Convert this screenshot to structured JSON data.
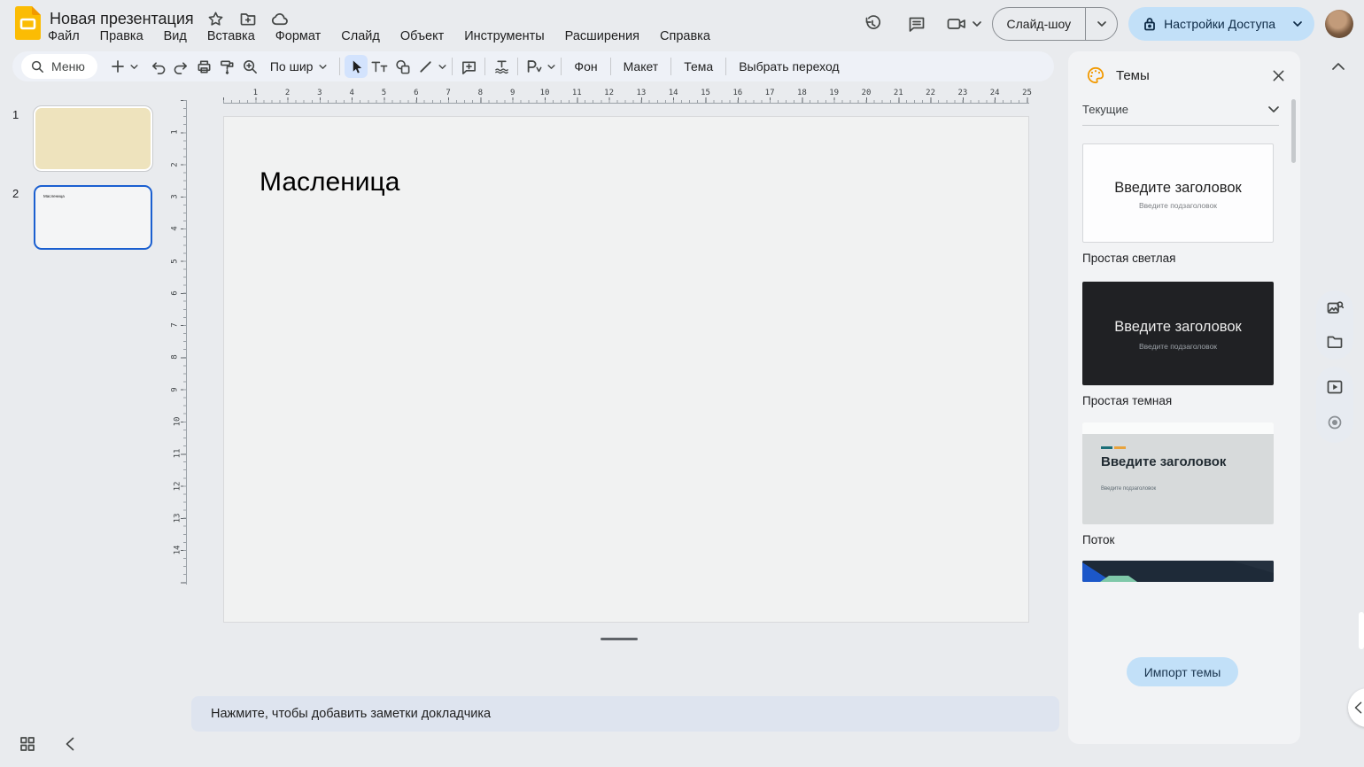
{
  "colors": {
    "page_bg": "#e9ebee",
    "toolbar_bg": "#eef1f7",
    "icon_gray": "#444746",
    "accent_blue": "#1a73e8",
    "selection_blue": "#d3e3fd",
    "share_button_bg": "#c2e0f8",
    "share_button_text": "#0d2a46",
    "logo_yellow": "#fbbc04",
    "logo_fold": "#f29900",
    "palette_amber": "#f29900",
    "slide1_fill": "#eee3bd",
    "selected_border": "#1a5fd0",
    "notes_bg": "#dee4ef",
    "panel_bg": "#f2f3f5",
    "dark_card": "#202124",
    "flow_card": "#d7dadb",
    "stream_navy": "#1e2a38",
    "stream_blue": "#1c57c9",
    "stream_green": "#7fc8a9"
  },
  "header": {
    "title": "Новая презентация",
    "menus": [
      "Файл",
      "Правка",
      "Вид",
      "Вставка",
      "Формат",
      "Слайд",
      "Объект",
      "Инструменты",
      "Расширения",
      "Справка"
    ],
    "slideshow_label": "Слайд-шоу",
    "share_label": "Настройки Доступа"
  },
  "toolbar": {
    "search_label": "Меню",
    "zoom_fit_label": "По шир",
    "background_label": "Фон",
    "layout_label": "Макет",
    "theme_label": "Тема",
    "transition_label": "Выбрать переход"
  },
  "filmstrip": {
    "slides": [
      {
        "number": "1",
        "title": ""
      },
      {
        "number": "2",
        "title": "Масленица"
      }
    ]
  },
  "slide_canvas": {
    "title": "Масленица"
  },
  "rulers": {
    "horizontal": [
      1,
      2,
      3,
      4,
      5,
      6,
      7,
      8,
      9,
      10,
      11,
      12,
      13,
      14,
      15,
      16,
      17,
      18,
      19,
      20,
      21,
      22,
      23,
      24,
      25
    ],
    "vertical": [
      1,
      2,
      3,
      4,
      5,
      6,
      7,
      8,
      9,
      10,
      11,
      12,
      13,
      14
    ]
  },
  "themes_panel": {
    "title": "Темы",
    "section_label": "Текущие",
    "placeholder_title": "Введите заголовок",
    "placeholder_subtitle": "Введите подзаголовок",
    "themes": [
      {
        "name": "Простая светлая"
      },
      {
        "name": "Простая темная"
      },
      {
        "name": "Поток"
      }
    ],
    "import_button_label": "Импорт темы"
  },
  "notes": {
    "placeholder": "Нажмите, чтобы добавить заметки докладчика"
  }
}
